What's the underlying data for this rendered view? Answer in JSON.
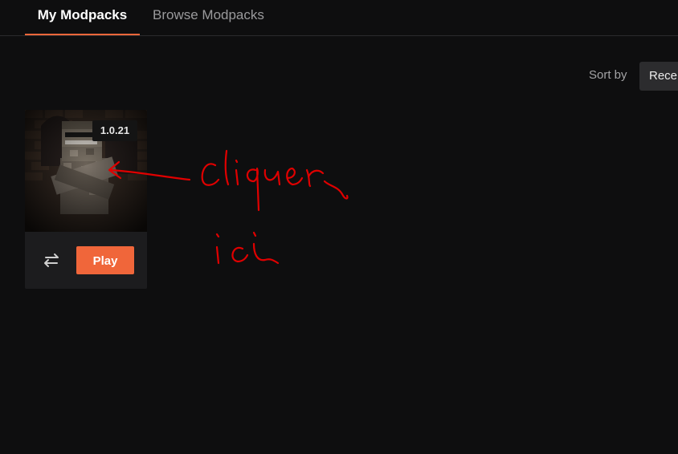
{
  "tabs": [
    {
      "label": "My Modpacks",
      "active": true
    },
    {
      "label": "Browse Modpacks",
      "active": false
    }
  ],
  "sort": {
    "label": "Sort by",
    "selected": "Recent"
  },
  "modpack_card": {
    "version": "1.0.21",
    "play_label": "Play",
    "swap_icon": "swap-arrows-icon"
  },
  "annotation": {
    "handwritten_text_line1": "cliquer",
    "handwritten_text_line2": "ici",
    "color": "#e00000"
  },
  "colors": {
    "accent": "#f0663a",
    "background": "#0e0e0f",
    "card": "#1c1c1e"
  }
}
